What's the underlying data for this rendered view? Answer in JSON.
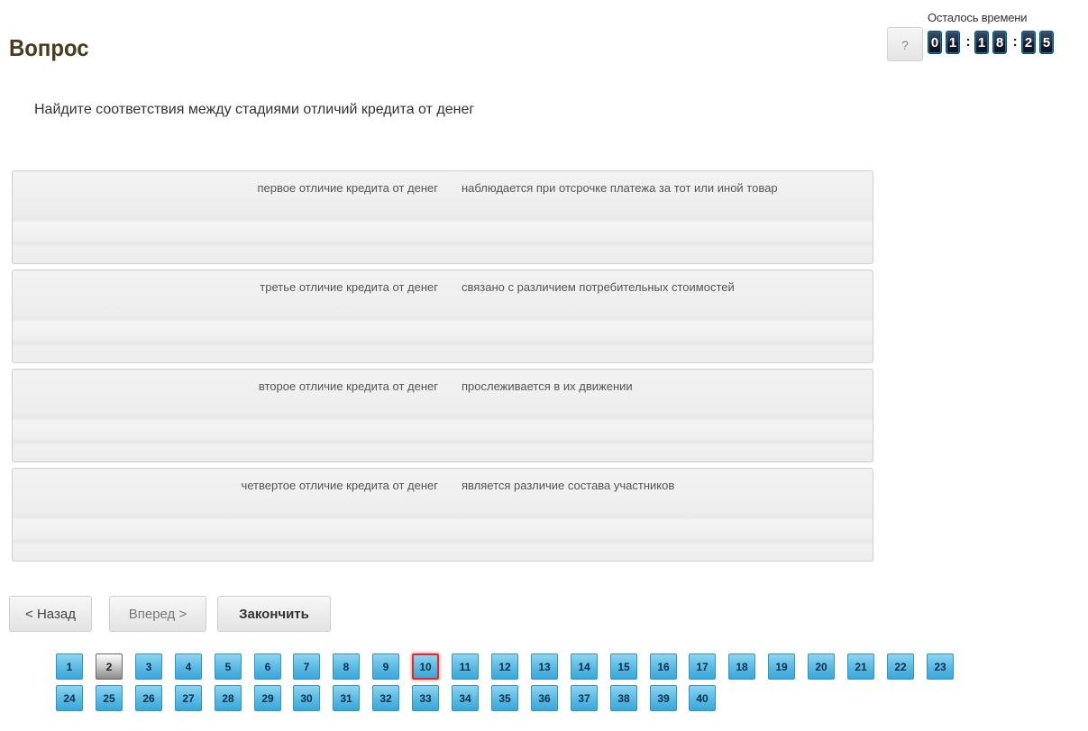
{
  "header": {
    "title": "Вопрос",
    "help_label": "?",
    "timer_label": "Осталось времени",
    "timer": {
      "hours": [
        "0",
        "1"
      ],
      "minutes": [
        "1",
        "8"
      ],
      "seconds": [
        "2",
        "5"
      ],
      "separator": ":"
    }
  },
  "question": {
    "text": "Найдите соответствия между стадиями отличий кредита от денег",
    "pairs": [
      {
        "left": "первое отличие кредита от денег",
        "right": "наблюдается при отсрочке платежа за тот или иной товар"
      },
      {
        "left": "третье отличие кредита от денег",
        "right": "связано с различием потребительных стоимостей"
      },
      {
        "left": "второе отличие кредита от денег",
        "right": "прослеживается в их движении"
      },
      {
        "left": "четвертое отличие кредита от денег",
        "right": "является различие состава участников"
      }
    ]
  },
  "navigation": {
    "back_label": "< Назад",
    "next_label": "Вперед >",
    "finish_label": "Закончить"
  },
  "question_nav": {
    "current": "2",
    "flagged": "10",
    "row1": [
      "1",
      "2",
      "3",
      "4",
      "5",
      "6",
      "7",
      "8",
      "9",
      "10",
      "11",
      "12",
      "13",
      "14",
      "15",
      "16",
      "17",
      "18",
      "19",
      "20",
      "21",
      "22",
      "23"
    ],
    "row2": [
      "24",
      "25",
      "26",
      "27",
      "28",
      "29",
      "30",
      "31",
      "32",
      "33",
      "34",
      "35",
      "36",
      "37",
      "38",
      "39",
      "40"
    ]
  },
  "colors": {
    "question_button": "#5cbce6",
    "current_button": "#c9c9c9",
    "flagged_border": "#e12c2c",
    "timer_digit": "#1f2636"
  }
}
